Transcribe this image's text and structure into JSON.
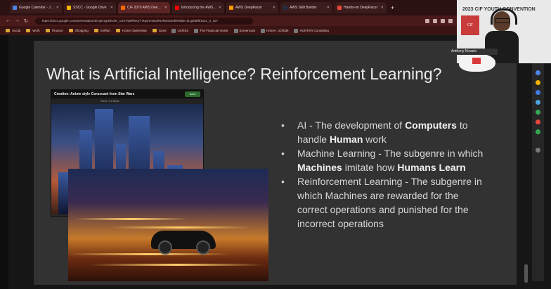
{
  "browser": {
    "tabs": [
      {
        "label": "Google Calendar - July 2023",
        "favicon_color": "#4a86e8",
        "active": false
      },
      {
        "label": "SSCC - Google Drive",
        "favicon_color": "#f4b400",
        "active": false
      },
      {
        "label": "CIF 2070 AWS DeepRacer Works",
        "favicon_color": "#ff6a00",
        "active": true
      },
      {
        "label": "Introducing the AWS DeepRacer",
        "favicon_color": "#ff0000",
        "active": false
      },
      {
        "label": "AWS DeepRacer",
        "favicon_color": "#ff9900",
        "active": false
      },
      {
        "label": "AWS Skill Builder",
        "favicon_color": "#232f3e",
        "active": false
      },
      {
        "label": "Hands-on DeepRacer",
        "favicon_color": "#e8473d",
        "active": false
      }
    ],
    "url": "https://docs.google.com/presentation/d/1qKmjpDhz0K_GzKYbdRfwQT-iXqwVmBd0Nvh8G5/edit#slide=id.g2b8f9f102c_0_157",
    "bookmarks": [
      "Social",
      "Work",
      "Finance",
      "Shopping",
      "Sniffurt",
      "Home Ownership",
      "Guns",
      "UCRSS",
      "The Financial Invest",
      "Screencast",
      "Home | UCRide",
      "HUNTER Consulting"
    ]
  },
  "slide": {
    "title": "What is Artificial Intelligence? Reinforcement Learning?",
    "image_caption": "Creation: Anime style Coruscant from Star Wars",
    "image_button": "Save",
    "image_subcaption": "SDXL 1.0 Beta",
    "bullets": [
      {
        "pre": "AI - The development of ",
        "b1": "Computers",
        "mid": " to handle ",
        "b2": "Human",
        "post": " work"
      },
      {
        "pre": "Machine Learning - The subgenre in which ",
        "b1": "Machines",
        "mid": " imitate how ",
        "b2": "Humans Learn",
        "post": ""
      },
      {
        "pre": "Reinforcement Learning - The subgenre in which Machines are rewarded for the correct operations and punished for the incorrect operations",
        "b1": "",
        "mid": "",
        "b2": "",
        "post": ""
      }
    ]
  },
  "webcam": {
    "banner": "2023 CIF YOUTH CONVENTION",
    "logo_text": "CIF",
    "name_tag": "Anthony Nicasio"
  },
  "colors": {
    "tabbar": "#2b1111",
    "slide_bg": "#323232",
    "slide_text": "#d6d6d6"
  }
}
